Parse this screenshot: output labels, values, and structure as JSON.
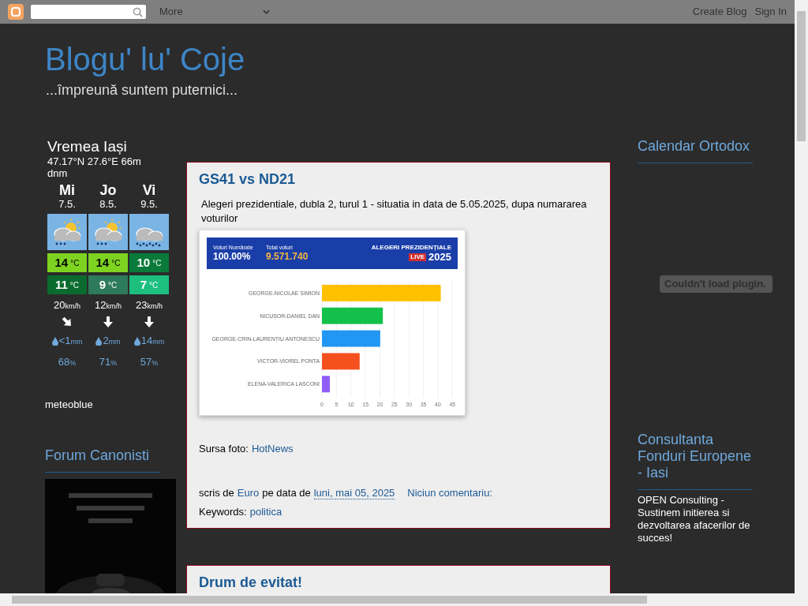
{
  "navbar": {
    "more": "More",
    "links": [
      "Create Blog",
      "Sign In"
    ]
  },
  "blog": {
    "title": "Blogu' lu' Coje",
    "description": "...împreună suntem puternici..."
  },
  "weather": {
    "title": "Vremea Iași",
    "coords": "47.17°N 27.6°E 66m dnm",
    "credit": "meteoblue",
    "days": [
      {
        "day": "Mi",
        "date": "7.5.",
        "kind": "sun-cloud-rain",
        "high": {
          "value": "14",
          "unit": "°C",
          "color": "#7ed321"
        },
        "low": {
          "value": "11",
          "unit": "°C",
          "color": "#0b6b2e"
        },
        "wind": {
          "value": "20",
          "unit": "km/h",
          "kind": "diagonal"
        },
        "rain": {
          "value": "<1",
          "unit": "mm"
        },
        "humidity": {
          "value": "68",
          "unit": "%"
        }
      },
      {
        "day": "Jo",
        "date": "8.5.",
        "kind": "sun-cloud-rain",
        "high": {
          "value": "14",
          "unit": "°C",
          "color": "#7ed321"
        },
        "low": {
          "value": "9",
          "unit": "°C",
          "color": "#2e7a5c"
        },
        "wind": {
          "value": "12",
          "unit": "km/h",
          "kind": "down"
        },
        "rain": {
          "value": "2",
          "unit": "mm"
        },
        "humidity": {
          "value": "71",
          "unit": "%"
        }
      },
      {
        "day": "Vi",
        "date": "9.5.",
        "kind": "cloud-heavy-rain",
        "high": {
          "value": "10",
          "unit": "°C",
          "color": "#0a7a3a"
        },
        "low": {
          "value": "7",
          "unit": "°C",
          "color": "#1dbf7f"
        },
        "wind": {
          "value": "23",
          "unit": "km/h",
          "kind": "down"
        },
        "rain": {
          "value": "14",
          "unit": "mm"
        },
        "humidity": {
          "value": "57",
          "unit": "%"
        }
      }
    ]
  },
  "forum": {
    "title": "Forum Canonisti"
  },
  "posts": [
    {
      "title": "GS41 vs ND21",
      "body": "Alegeri prezidentiale, dubla 2, turul 1 - situatia in data de 5.05.2025, dupa numararea voturilor",
      "image": {
        "header": {
          "counted_label": "Voturi Numărate",
          "counted": "100.00%",
          "total_label": "Total voturi",
          "total": "9.571.740",
          "event": "ALEGERI PREZIDENȚIALE",
          "live": "LIVE",
          "year": "2025"
        },
        "chart_data": {
          "type": "bar",
          "orientation": "horizontal",
          "grid": true,
          "series": [
            {
              "name": "GEORGE-NICOLAE SIMION",
              "color": "#ffc000",
              "values": [
                41
              ]
            },
            {
              "name": "NICUȘOR-DANIEL DAN",
              "color": "#13c04a",
              "values": [
                21
              ]
            },
            {
              "name": "GEORGE-CRIN-LAURENȚIU ANTONESCU",
              "color": "#2196f3",
              "values": [
                20.1
              ]
            },
            {
              "name": "VICTOR-VIOREL PONTA",
              "color": "#f4511e",
              "values": [
                13
              ]
            },
            {
              "name": "ELENA-VALERICA LASCONI",
              "color": "#8e5cf6",
              "values": [
                2.7
              ]
            }
          ],
          "xlim": [
            0,
            45
          ],
          "xticks": [
            0,
            5,
            10,
            15,
            20,
            25,
            30,
            35,
            40,
            45
          ]
        }
      },
      "source_label": "Sursa foto:",
      "source_link": "HotNews",
      "author_label": "scris de",
      "author": "Euro",
      "date_label": "pe data de",
      "date": "luni, mai 05, 2025",
      "comments": "Niciun comentariu:",
      "keywords_label": "Keywords:",
      "keywords": [
        "politica"
      ]
    },
    {
      "title": "Drum de evitat!"
    }
  ],
  "right_sidebar": [
    {
      "kind": "plugin",
      "title": "Calendar Ortodox",
      "message": "Couldn't load plugin."
    },
    {
      "kind": "text",
      "title": "Consultanta Fonduri Europene - Iasi",
      "text": "OPEN Consulting - Sustinem initierea si dezvoltarea afacerilor de succes!"
    }
  ]
}
